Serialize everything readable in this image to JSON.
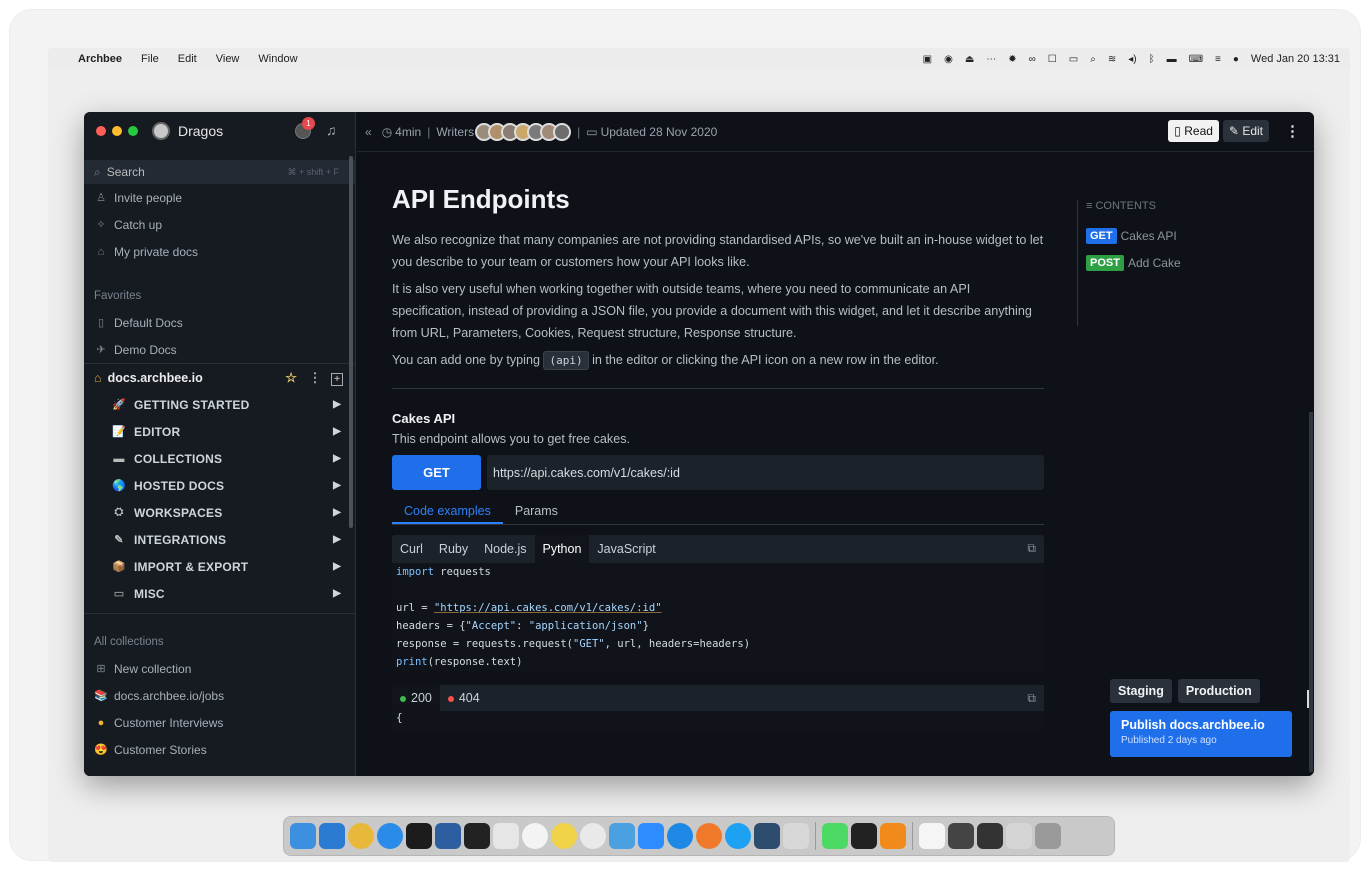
{
  "menubar": {
    "apple": "",
    "app_name": "Archbee",
    "items": [
      "File",
      "Edit",
      "View",
      "Window"
    ],
    "clock": "Wed Jan 20  13:31",
    "tray_icons": [
      "screen-record-icon",
      "eye-icon",
      "upload-icon",
      "dots-icon",
      "gear-icon",
      "glasses-icon",
      "window-icon",
      "battery-icon",
      "search-icon",
      "wifi-icon",
      "volume-icon",
      "bluetooth-icon",
      "flag-icon",
      "keyboard-icon",
      "control-center-icon",
      "siri-icon"
    ]
  },
  "sidebar": {
    "user_name": "Dragos",
    "notification_count": "1",
    "search": {
      "label": "Search",
      "shortcut": "⌘ + shift + F"
    },
    "quick_items": [
      {
        "icon": "invite-icon",
        "label": "Invite people"
      },
      {
        "icon": "catch-up-icon",
        "label": "Catch up"
      },
      {
        "icon": "lock-icon",
        "label": "My private docs"
      }
    ],
    "favorites_title": "Favorites",
    "favorites": [
      {
        "icon": "doc-icon",
        "label": "Default Docs"
      },
      {
        "icon": "plane-icon",
        "label": "Demo Docs"
      }
    ],
    "workspace": {
      "label": "docs.archbee.io"
    },
    "nav_items": [
      {
        "icon": "🚀",
        "label": "GETTING STARTED"
      },
      {
        "icon": "📝",
        "label": "EDITOR"
      },
      {
        "icon": "▬",
        "label": "COLLECTIONS"
      },
      {
        "icon": "🌎",
        "label": "HOSTED DOCS"
      },
      {
        "icon": "⛭",
        "label": "WORKSPACES"
      },
      {
        "icon": "✎",
        "label": "INTEGRATIONS"
      },
      {
        "icon": "📦",
        "label": "IMPORT & EXPORT"
      },
      {
        "icon": "▭",
        "label": "MISC"
      }
    ],
    "collections_title": "All collections",
    "collections": [
      {
        "icon": "⊞",
        "label": "New collection"
      },
      {
        "icon": "📚",
        "label": "docs.archbee.io/jobs"
      },
      {
        "icon": "●",
        "label": "Customer Interviews"
      },
      {
        "icon": "😍",
        "label": "Customer Stories"
      }
    ]
  },
  "topbar": {
    "collapse": "«",
    "read_time": "4min",
    "writers_label": "Writers",
    "updated": "Updated 28 Nov 2020",
    "read_label": "Read",
    "edit_label": "Edit"
  },
  "doc": {
    "title": "API Endpoints",
    "para1": "We also recognize that many companies are not providing standardised APIs, so we've built an in-house widget to let you describe to your team or customers how your API looks like.",
    "para2": "It is also very useful when working together with outside teams, where you need to communicate an API specification, instead of providing a JSON file, you provide a document with this widget, and let it describe anything from URL, Parameters, Cookies, Request structure, Response structure.",
    "para3_before": "You can add one by typing",
    "para3_code": "(api)",
    "para3_after": "in the editor or clicking the API icon on a new row in the editor.",
    "api_title": "Cakes API",
    "api_desc": "This endpoint allows you to get free cakes.",
    "method": "GET",
    "url": "https://api.cakes.com/v1/cakes/:id",
    "subtabs": [
      "Code examples",
      "Params"
    ],
    "langs": [
      "Curl",
      "Ruby",
      "Node.js",
      "Python",
      "JavaScript"
    ],
    "active_lang": "Python",
    "code": {
      "l1_kw": "import",
      "l1_rest": " requests",
      "l3_a": "url = ",
      "l3_url": "\"https://api.cakes.com/v1/cakes/:id\"",
      "l4_a": "headers = {",
      "l4_k": "\"Accept\"",
      "l4_b": ": ",
      "l4_v": "\"application/json\"",
      "l4_c": "}",
      "l5_a": "response = requests.request(",
      "l5_m": "\"GET\"",
      "l5_b": ", url, headers=headers)",
      "l6_kw": "print",
      "l6_rest": "(response.text)"
    },
    "responses": [
      "200",
      "404"
    ],
    "response_body_first": "{"
  },
  "toc": {
    "title": "CONTENTS",
    "items": [
      {
        "method": "GET",
        "label": "Cakes API"
      },
      {
        "method": "POST",
        "label": "Add Cake"
      }
    ]
  },
  "env": {
    "staging": "Staging",
    "production": "Production"
  },
  "publish": {
    "title": "Publish docs.archbee.io",
    "subtitle": "Published 2 days ago"
  },
  "colors": {
    "accent": "#1f6feb",
    "post": "#2ea043",
    "bg": "#0e1117",
    "sidebar": "#161b22"
  },
  "dock": [
    "finder-icon",
    "vscode-icon",
    "chrome-icon",
    "safari-icon",
    "terminal-icon",
    "xcode-icon",
    "figma-icon",
    "script-icon",
    "slack-icon",
    "mail-icon",
    "app-icon",
    "zoom-icon",
    "messenger-icon",
    "compass-icon",
    "twitter-icon",
    "ai-icon",
    "palette-icon",
    "messages-icon",
    "iterm-icon",
    "vlc-icon",
    "doc-icon",
    "screen-icon",
    "screen2-icon",
    "screen3-icon",
    "trash-icon"
  ]
}
